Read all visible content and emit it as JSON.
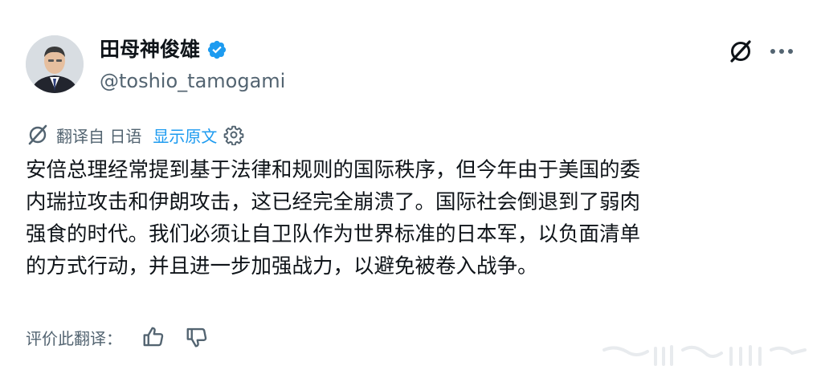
{
  "author": {
    "display_name": "田母神俊雄",
    "handle": "@toshio_tamogami",
    "avatar_icon": "avatar-photo",
    "verified_icon": "verified-badge-icon",
    "verified_color": "#1d9bf0"
  },
  "header_actions": {
    "grok_icon": "grok-icon",
    "more_icon": "more-icon"
  },
  "translation": {
    "icon": "translate-icon",
    "label": "翻译自 日语",
    "show_original": "显示原文",
    "settings_icon": "gear-icon",
    "link_color": "#1d9bf0"
  },
  "post": {
    "text": "安倍总理经常提到基于法律和规则的国际秩序，但今年由于美国的委\n内瑞拉攻击和伊朗攻击，这已经完全崩溃了。国际社会倒退到了弱肉\n强食的时代。我们必须让自卫队作为世界标准的日本军，以负面清单\n的方式行动，并且进一步加强战力，以避免被卷入战争。"
  },
  "rate_translation": {
    "label": "评价此翻译：",
    "thumbs_up_icon": "thumbs-up-icon",
    "thumbs_down_icon": "thumbs-down-icon"
  },
  "colors": {
    "text_primary": "#0f1419",
    "text_secondary": "#536471",
    "background": "#ffffff"
  }
}
